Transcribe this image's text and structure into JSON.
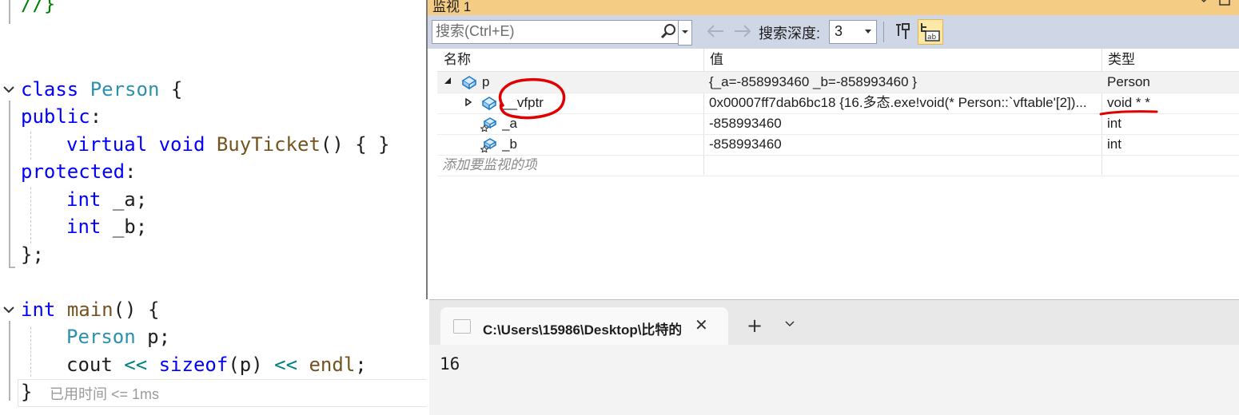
{
  "editor": {
    "lines": {
      "l0": "//}",
      "l1_kw": "class",
      "l1_name": "Person",
      "l1_brace": "{",
      "l2": "public",
      "l2_colon": ":",
      "l3_kw1": "virtual",
      "l3_kw2": "void",
      "l3_fn": "BuyTicket",
      "l3_rest": "() { }",
      "l4": "protected",
      "l4_colon": ":",
      "l5_kw": "int",
      "l5_var": "_a;",
      "l6_kw": "int",
      "l6_var": "_b;",
      "l7": "};",
      "l8_kw": "int",
      "l8_fn": "main",
      "l8_rest": "() {",
      "l9_type": "Person",
      "l9_var": "p;",
      "l10_a": "cout",
      "l10_op1": "<<",
      "l10_kw": "sizeof",
      "l10_p": "(p)",
      "l10_op2": "<<",
      "l10_endl": "endl",
      "l10_semi": ";",
      "l11": "}"
    },
    "elapsed": "已用时间 <= 1ms"
  },
  "watch": {
    "title": "监视 1",
    "search_placeholder": "搜索(Ctrl+E)",
    "depth_label": "搜索深度:",
    "depth_value": "3",
    "columns": {
      "name": "名称",
      "value": "值",
      "type": "类型"
    },
    "rows": [
      {
        "name": "p",
        "value": "{_a=-858993460 _b=-858993460 }",
        "type": "Person"
      },
      {
        "name": "__vfptr",
        "value": "0x00007ff7dab6bc18 {16.多态.exe!void(* Person::`vftable'[2])...",
        "type": "void * *"
      },
      {
        "name": "_a",
        "value": "-858993460",
        "type": "int"
      },
      {
        "name": "_b",
        "value": "-858993460",
        "type": "int"
      }
    ],
    "add_item": "添加要监视的项"
  },
  "terminal": {
    "tab_title": "C:\\Users\\15986\\Desktop\\比特的",
    "close_glyph": "✕",
    "new_tab_glyph": "+",
    "output": "16"
  },
  "colors": {
    "title_bar": "#f5cc84",
    "toolbar": "#cfd6e5",
    "annotation": "#e00000"
  }
}
